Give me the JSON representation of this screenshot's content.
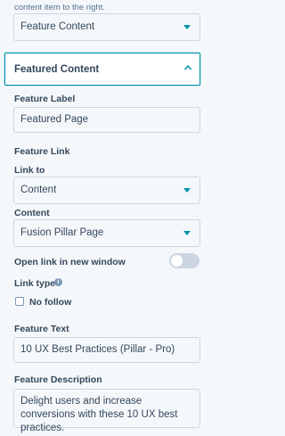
{
  "intro_text": "content item to the right.",
  "content_type_select": {
    "value": "Feature Content"
  },
  "section": {
    "title": "Featured Content"
  },
  "feature_label": {
    "label": "Feature Label",
    "value": "Featured Page"
  },
  "feature_link": {
    "heading": "Feature Link"
  },
  "link_to": {
    "label": "Link to",
    "value": "Content"
  },
  "content": {
    "label": "Content",
    "value": "Fusion Pillar Page"
  },
  "new_window": {
    "label": "Open link in new window",
    "on": false
  },
  "link_type": {
    "label": "Link type",
    "info_icon": "i",
    "option_label": "No follow",
    "checked": false
  },
  "feature_text": {
    "label": "Feature Text",
    "value": "10 UX Best Practices (Pillar - Pro)"
  },
  "feature_description": {
    "label": "Feature Description",
    "value": "Delight users and increase conversions with these 10 UX best practices."
  },
  "colors": {
    "accent": "#0091ae",
    "text": "#33475b",
    "border": "#cbd6e2",
    "background": "#f5f8fa"
  }
}
